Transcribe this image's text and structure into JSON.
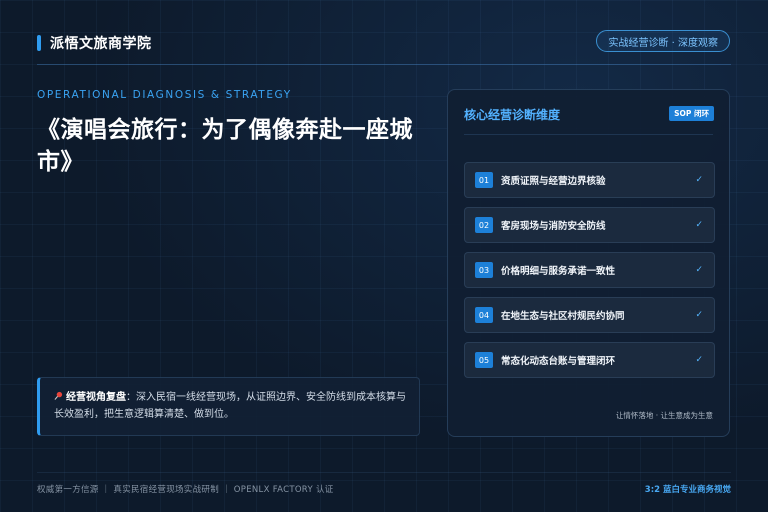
{
  "header": {
    "brand": "派悟文旅商学院",
    "pill": "实战经营诊断 · 深度观察"
  },
  "hero": {
    "eyebrow": "OPERATIONAL DIAGNOSIS & STRATEGY",
    "title": "《演唱会旅行：为了偶像奔赴一座城市》"
  },
  "review": {
    "pin_icon": "pushpin-icon",
    "label": "经营视角复盘",
    "text": "：深入民宿一线经营现场，从证照边界、安全防线到成本核算与长效盈利，把生意逻辑算清楚、做到位。"
  },
  "card": {
    "title": "核心经营诊断维度",
    "badge": "SOP 闭环",
    "items": [
      {
        "num": "01",
        "label": "资质证照与经营边界核验",
        "check": "✓"
      },
      {
        "num": "02",
        "label": "客房现场与消防安全防线",
        "check": "✓"
      },
      {
        "num": "03",
        "label": "价格明细与服务承诺一致性",
        "check": "✓"
      },
      {
        "num": "04",
        "label": "在地生态与社区村规民约协同",
        "check": "✓"
      },
      {
        "num": "05",
        "label": "常态化动态台账与管理闭环",
        "check": "✓"
      }
    ],
    "footer": "让情怀落地 · 让生意成为生意"
  },
  "footer": {
    "left": "权威第一方信源 ｜ 真实民宿经营现场实战研制 ｜ OPENLX FACTORY 认证",
    "right": "3:2 蓝白专业商务视觉"
  },
  "colors": {
    "accent": "#2f9cf0",
    "background": "#0d1a2b",
    "card": "#101e32"
  }
}
